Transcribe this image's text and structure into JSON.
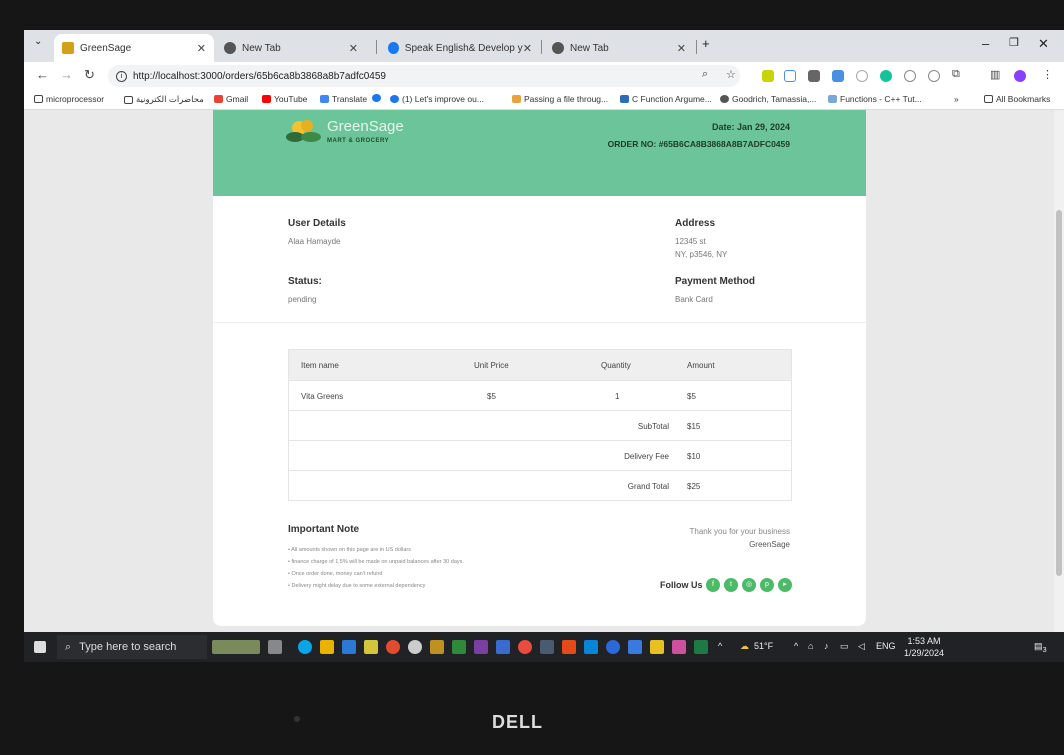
{
  "tabs": [
    {
      "label": "GreenSage",
      "active": true
    },
    {
      "label": "New Tab",
      "active": false
    },
    {
      "label": "Speak English& Develop your p",
      "active": false
    },
    {
      "label": "New Tab",
      "active": false
    }
  ],
  "address_bar": {
    "url": "http://localhost:3000/orders/65b6ca8b3868a8b7adfc0459"
  },
  "bookmarks": [
    {
      "label": "microprocessor"
    },
    {
      "label": "محاضرات الكترونية"
    },
    {
      "label": "Gmail"
    },
    {
      "label": "YouTube"
    },
    {
      "label": "Translate"
    },
    {
      "label": "(1) Let's improve ou..."
    },
    {
      "label": "Passing a file throug..."
    },
    {
      "label": "C Function Argume..."
    },
    {
      "label": "Goodrich, Tamassia,..."
    },
    {
      "label": "Functions - C++ Tut..."
    },
    {
      "label": "»"
    },
    {
      "label": "All Bookmarks"
    }
  ],
  "invoice": {
    "brand_name": "GreenSage",
    "brand_tagline": "MART & GROCERY",
    "date": "Date: Jan 29, 2024",
    "order_no": "ORDER NO: #65B6CA8B3868A8B7ADFC0459",
    "user_details_title": "User Details",
    "user_name": "Alaa Hamayde",
    "address_title": "Address",
    "address_line1": "12345 st",
    "address_line2": "NY, p3546, NY",
    "status_title": "Status:",
    "status_value": "pending",
    "payment_title": "Payment Method",
    "payment_value": "Bank Card",
    "table": {
      "headers": [
        "Item name",
        "Unit Price",
        "Quantity",
        "Amount"
      ],
      "item": {
        "name": "Vita Greens",
        "unit_price": "$5",
        "quantity": "1",
        "amount": "$5"
      },
      "subtotal_label": "SubTotal",
      "subtotal_value": "$15",
      "delivery_label": "Delivery Fee",
      "delivery_value": "$10",
      "grand_label": "Grand Total",
      "grand_value": "$25"
    },
    "note_title": "Important Note",
    "notes": [
      "All amounts shown on this page are in US dollars",
      "finance charge of 1.5% will be made on unpaid balances after 30 days.",
      "Once order done, money can't refund",
      "Delivery might delay due to some external dependency"
    ],
    "thanks": "Thank you for your business",
    "thanks_brand": "GreenSage",
    "follow_us": "Follow Us"
  },
  "taskbar": {
    "search_placeholder": "Type here to search",
    "weather": "51°F",
    "lang": "ENG",
    "time": "1:53 AM",
    "date": "1/29/2024",
    "notifications": "3"
  },
  "monitor_brand": "DELL",
  "colors": {
    "accent_green": "#6cc49a",
    "social_green": "#4cbb68"
  }
}
